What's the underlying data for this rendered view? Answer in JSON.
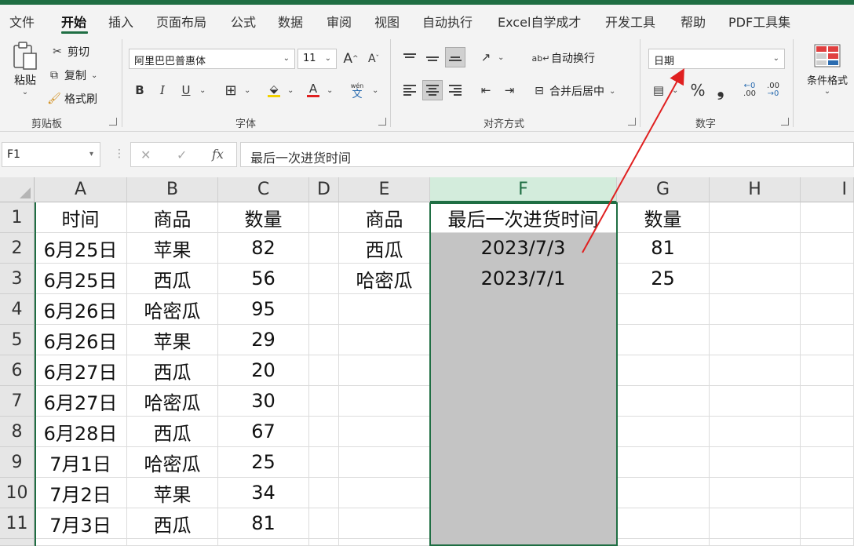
{
  "menu": {
    "tabs": [
      "文件",
      "开始",
      "插入",
      "页面布局",
      "公式",
      "数据",
      "审阅",
      "视图",
      "自动执行",
      "Excel自学成才",
      "开发工具",
      "帮助",
      "PDF工具集"
    ],
    "active_index": 1
  },
  "ribbon": {
    "clipboard": {
      "paste": "粘贴",
      "cut": "剪切",
      "copy": "复制",
      "format_painter": "格式刷",
      "label": "剪贴板"
    },
    "font": {
      "font_name": "阿里巴巴普惠体",
      "font_size": "11",
      "grow": "A",
      "shrink": "A",
      "bold": "B",
      "italic": "I",
      "underline": "U",
      "font_color_glyph": "A",
      "phonetic_top": "wén",
      "phonetic_bottom": "文",
      "label": "字体"
    },
    "alignment": {
      "wrap_text": "自动换行",
      "merge_center": "合并后居中",
      "label": "对齐方式"
    },
    "number": {
      "format": "日期",
      "percent": "%",
      "comma": "❟",
      "label": "数字"
    },
    "styles": {
      "conditional_format": "条件格式"
    }
  },
  "formula_bar": {
    "name_box": "F1",
    "cancel": "✕",
    "enter": "✓",
    "fx": "fx",
    "content": "最后一次进货时间"
  },
  "sheet": {
    "columns": [
      "A",
      "B",
      "C",
      "D",
      "E",
      "F",
      "G",
      "H",
      "I"
    ],
    "selected_column": "F",
    "rows": [
      "1",
      "2",
      "3",
      "4",
      "5",
      "6",
      "7",
      "8",
      "9",
      "10",
      "11"
    ],
    "col_A": [
      "时间",
      "6月25日",
      "6月25日",
      "6月26日",
      "6月26日",
      "6月27日",
      "6月27日",
      "6月28日",
      "7月1日",
      "7月2日",
      "7月3日"
    ],
    "col_B": [
      "商品",
      "苹果",
      "西瓜",
      "哈密瓜",
      "苹果",
      "西瓜",
      "哈密瓜",
      "西瓜",
      "哈密瓜",
      "苹果",
      "西瓜"
    ],
    "col_C": [
      "数量",
      "82",
      "56",
      "95",
      "29",
      "20",
      "30",
      "67",
      "25",
      "34",
      "81"
    ],
    "col_E": [
      "商品",
      "西瓜",
      "哈密瓜"
    ],
    "col_F": [
      "最后一次进货时间",
      "2023/7/3",
      "2023/7/1"
    ],
    "col_G": [
      "数量",
      "81",
      "25"
    ]
  },
  "colors": {
    "accent": "#1f6e43",
    "selection_fill": "#c4c4c4",
    "annotation_arrow": "#e02020"
  }
}
